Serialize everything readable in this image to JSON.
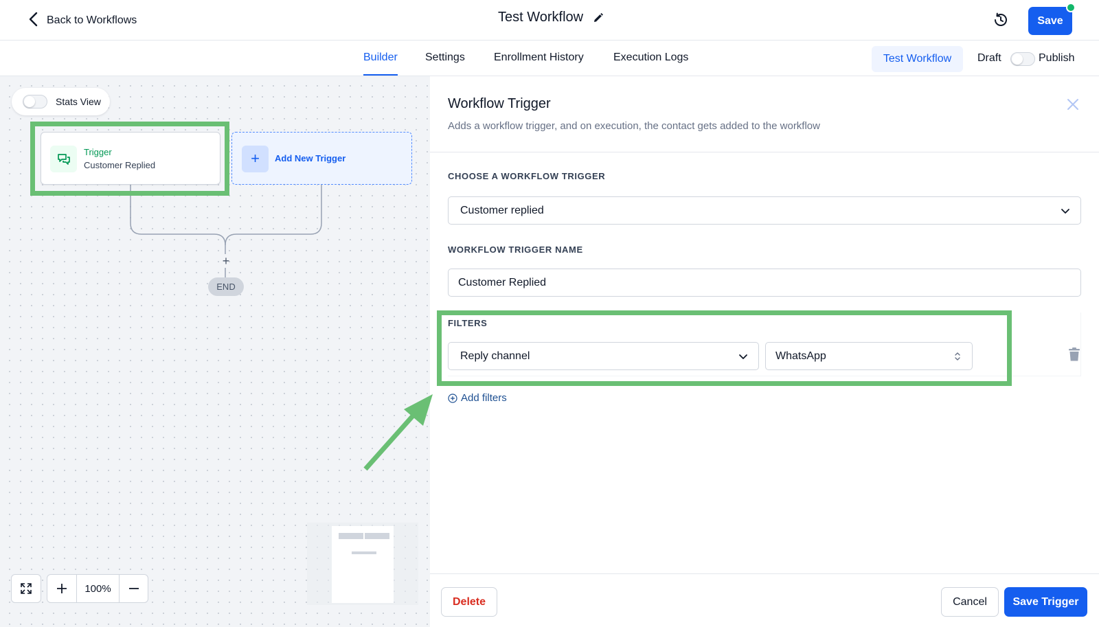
{
  "header": {
    "back_label": "Back to Workflows",
    "title": "Test Workflow",
    "save_label": "Save",
    "history_icon": "history-icon",
    "edit_icon": "pencil-icon"
  },
  "tabs": [
    {
      "label": "Builder",
      "active": true
    },
    {
      "label": "Settings",
      "active": false
    },
    {
      "label": "Enrollment History",
      "active": false
    },
    {
      "label": "Execution Logs",
      "active": false
    }
  ],
  "actions": {
    "test_label": "Test Workflow",
    "draft_label": "Draft",
    "publish_label": "Publish",
    "published": false
  },
  "canvas": {
    "stats_view_label": "Stats View",
    "stats_view_on": false,
    "trigger_node": {
      "title": "Trigger",
      "subtitle": "Customer Replied"
    },
    "add_trigger_label": "Add New Trigger",
    "add_step_symbol": "+",
    "end_label": "END",
    "zoom_level": "100%"
  },
  "panel": {
    "title": "Workflow Trigger",
    "description": "Adds a workflow trigger, and on execution, the contact gets added to the workflow",
    "choose_trigger_label": "CHOOSE A WORKFLOW TRIGGER",
    "trigger_value": "Customer replied",
    "trigger_name_label": "WORKFLOW TRIGGER NAME",
    "trigger_name_value": "Customer Replied",
    "filters_label": "FILTERS",
    "filter_field": "Reply channel",
    "filter_value": "WhatsApp",
    "add_filters_label": "Add filters",
    "delete_label": "Delete",
    "cancel_label": "Cancel",
    "save_trigger_label": "Save Trigger"
  },
  "colors": {
    "accent": "#155eef",
    "annotation": "#6abf74",
    "trigger_green": "#039855",
    "danger": "#d92d20"
  }
}
